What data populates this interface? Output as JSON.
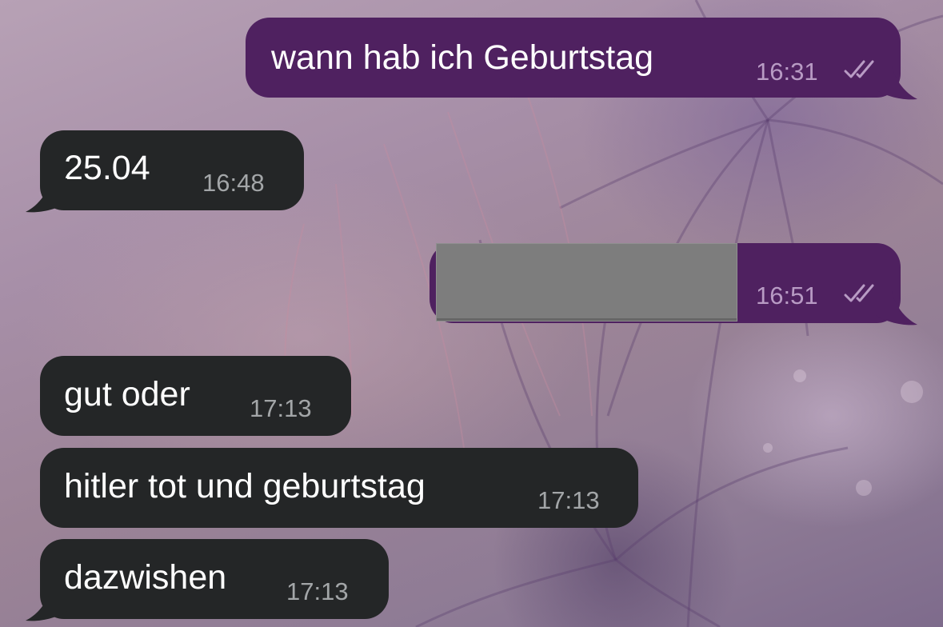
{
  "messages": [
    {
      "direction": "outgoing",
      "text": "wann hab ich Geburtstag",
      "time": "16:31",
      "status": "read-double-check"
    },
    {
      "direction": "incoming",
      "text": "25.04",
      "time": "16:48"
    },
    {
      "direction": "outgoing",
      "text": "",
      "time": "16:51",
      "status": "read-double-check",
      "content": "redacted-block"
    },
    {
      "direction": "incoming",
      "text": "gut oder",
      "time": "17:13"
    },
    {
      "direction": "incoming",
      "text": "hitler tot und geburtstag",
      "time": "17:13"
    },
    {
      "direction": "incoming",
      "text": "dazwishen",
      "time": "17:13"
    }
  ],
  "colors": {
    "outgoing_bubble": "#4f2160",
    "incoming_bubble": "#242627",
    "outgoing_time": "#b89bc4",
    "incoming_time": "#a3a6a8",
    "redaction": "#7d7d7d"
  }
}
